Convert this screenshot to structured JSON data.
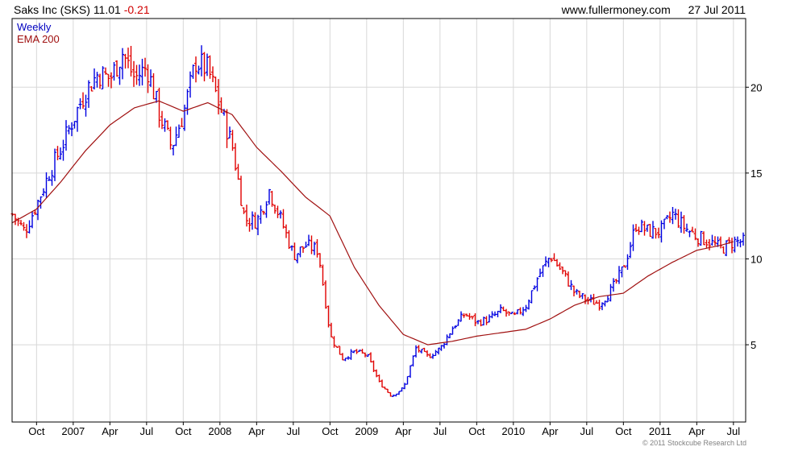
{
  "header": {
    "symbol": "Saks Inc (SKS)",
    "last": "11.01",
    "change": "-0.21",
    "site": "www.fullermoney.com",
    "date": "27 Jul 2011"
  },
  "copyright": "© 2011 Stockcube Research Ltd",
  "colors": {
    "up": "#0000e0",
    "down": "#e00000",
    "ema": "#a01010",
    "grid": "#d8d8d8",
    "axis": "#000000"
  },
  "chart_data": {
    "type": "ohlc_weekly_bars",
    "title": "Saks Inc (SKS) 11.01 -0.21",
    "legend": [
      {
        "name": "Weekly",
        "color": "#0000c0"
      },
      {
        "name": "EMA 200",
        "color": "#a01010"
      }
    ],
    "y_axis": {
      "position": "right",
      "ticks": [
        5,
        10,
        15,
        20
      ],
      "range": [
        0.5,
        24
      ]
    },
    "x_axis": {
      "ticks": [
        "Oct",
        "2007",
        "Apr",
        "Jul",
        "Oct",
        "2008",
        "Apr",
        "Jul",
        "Oct",
        "2009",
        "Apr",
        "Jul",
        "Oct",
        "2010",
        "Apr",
        "Jul",
        "Oct",
        "2011",
        "Apr",
        "Jul"
      ],
      "range": [
        "2006-08",
        "2011-07"
      ]
    },
    "price_anchors": [
      [
        "2006-08",
        12.6
      ],
      [
        "2006-09",
        11.6
      ],
      [
        "2006-10",
        13.2
      ],
      [
        "2006-11",
        15.0
      ],
      [
        "2006-12",
        16.5
      ],
      [
        "2007-01",
        18.2
      ],
      [
        "2007-02",
        19.8
      ],
      [
        "2007-03",
        20.8
      ],
      [
        "2007-04",
        20.5
      ],
      [
        "2007-05",
        22.0
      ],
      [
        "2007-06",
        20.5
      ],
      [
        "2007-07",
        21.2
      ],
      [
        "2007-08",
        18.5
      ],
      [
        "2007-09",
        16.5
      ],
      [
        "2007-10",
        18.5
      ],
      [
        "2007-11",
        21.5
      ],
      [
        "2007-12",
        21.0
      ],
      [
        "2008-01",
        18.8
      ],
      [
        "2008-02",
        16.5
      ],
      [
        "2008-03",
        12.3
      ],
      [
        "2008-04",
        12.2
      ],
      [
        "2008-05",
        14.0
      ],
      [
        "2008-06",
        12.2
      ],
      [
        "2008-07",
        10.2
      ],
      [
        "2008-08",
        10.8
      ],
      [
        "2008-09",
        10.5
      ],
      [
        "2008-10",
        5.5
      ],
      [
        "2008-11",
        4.2
      ],
      [
        "2008-12",
        4.6
      ],
      [
        "2009-01",
        4.4
      ],
      [
        "2009-02",
        2.8
      ],
      [
        "2009-03",
        2.0
      ],
      [
        "2009-04",
        2.5
      ],
      [
        "2009-05",
        4.8
      ],
      [
        "2009-06",
        4.3
      ],
      [
        "2009-07",
        4.8
      ],
      [
        "2009-08",
        6.0
      ],
      [
        "2009-09",
        6.8
      ],
      [
        "2009-10",
        6.3
      ],
      [
        "2009-11",
        6.5
      ],
      [
        "2009-12",
        7.0
      ],
      [
        "2010-01",
        6.6
      ],
      [
        "2010-02",
        7.3
      ],
      [
        "2010-03",
        9.0
      ],
      [
        "2010-04",
        10.2
      ],
      [
        "2010-05",
        9.2
      ],
      [
        "2010-06",
        8.0
      ],
      [
        "2010-07",
        7.6
      ],
      [
        "2010-08",
        7.4
      ],
      [
        "2010-09",
        8.2
      ],
      [
        "2010-10",
        9.5
      ],
      [
        "2010-11",
        12.0
      ],
      [
        "2010-12",
        11.6
      ],
      [
        "2011-01",
        11.6
      ],
      [
        "2011-02",
        12.6
      ],
      [
        "2011-03",
        11.8
      ],
      [
        "2011-04",
        11.3
      ],
      [
        "2011-05",
        11.0
      ],
      [
        "2011-06",
        10.6
      ],
      [
        "2011-07",
        11.0
      ]
    ],
    "ema_anchors": [
      [
        "2006-08",
        12.1
      ],
      [
        "2006-10",
        12.9
      ],
      [
        "2006-12",
        14.5
      ],
      [
        "2007-02",
        16.3
      ],
      [
        "2007-04",
        17.8
      ],
      [
        "2007-06",
        18.8
      ],
      [
        "2007-08",
        19.2
      ],
      [
        "2007-10",
        18.6
      ],
      [
        "2007-12",
        19.1
      ],
      [
        "2008-02",
        18.4
      ],
      [
        "2008-04",
        16.5
      ],
      [
        "2008-06",
        15.1
      ],
      [
        "2008-08",
        13.6
      ],
      [
        "2008-10",
        12.5
      ],
      [
        "2008-12",
        9.5
      ],
      [
        "2009-02",
        7.3
      ],
      [
        "2009-04",
        5.6
      ],
      [
        "2009-06",
        5.0
      ],
      [
        "2009-08",
        5.2
      ],
      [
        "2009-10",
        5.5
      ],
      [
        "2009-12",
        5.7
      ],
      [
        "2010-02",
        5.9
      ],
      [
        "2010-04",
        6.5
      ],
      [
        "2010-06",
        7.3
      ],
      [
        "2010-08",
        7.8
      ],
      [
        "2010-10",
        8.0
      ],
      [
        "2010-12",
        9.0
      ],
      [
        "2011-02",
        9.8
      ],
      [
        "2011-04",
        10.5
      ],
      [
        "2011-06",
        10.8
      ],
      [
        "2011-07",
        11.0
      ]
    ]
  }
}
